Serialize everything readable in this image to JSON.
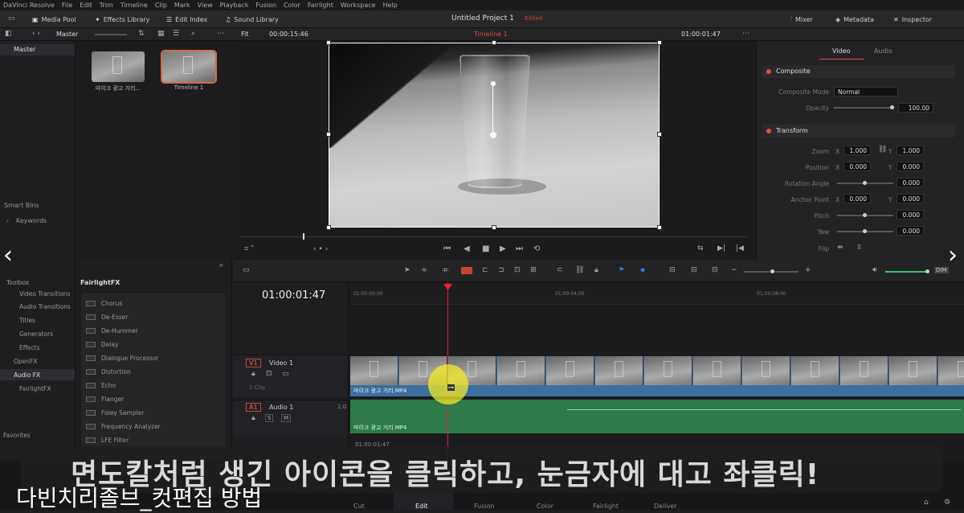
{
  "menu": [
    "DaVinci Resolve",
    "File",
    "Edit",
    "Trim",
    "Timeline",
    "Clip",
    "Mark",
    "View",
    "Playback",
    "Fusion",
    "Color",
    "Fairlight",
    "Workspace",
    "Help"
  ],
  "toolbar": {
    "media_pool": "Media Pool",
    "effects_library": "Effects Library",
    "edit_index": "Edit Index",
    "sound_library": "Sound Library",
    "project_title": "Untitled Project 1",
    "edited": "Edited",
    "mixer": "Mixer",
    "metadata": "Metadata",
    "inspector": "Inspector"
  },
  "subbar": {
    "master": "Master",
    "fit": "Fit",
    "timecode_left": "00:00:15:46",
    "timeline_name": "Timeline 1",
    "timecode_right": "01:00:01:47"
  },
  "bin": {
    "master": "Master",
    "smart_bins": "Smart Bins",
    "keywords": "Keywords"
  },
  "clips": [
    {
      "name": "마이크 광고 거리..."
    },
    {
      "name": "Timeline 1"
    }
  ],
  "inspector": {
    "tab_video": "Video",
    "tab_audio": "Audio",
    "composite": "Composite",
    "composite_mode_label": "Composite Mode",
    "composite_mode": "Normal",
    "opacity_label": "Opacity",
    "opacity": "100.00",
    "transform": "Transform",
    "zoom_label": "Zoom",
    "zoom_x": "1.000",
    "zoom_y": "1.000",
    "position_label": "Position",
    "position_x": "0.000",
    "position_y": "0.000",
    "rotation_label": "Rotation Angle",
    "rotation": "0.000",
    "anchor_label": "Anchor Point",
    "anchor_x": "0.000",
    "anchor_y": "0.000",
    "pitch_label": "Pitch",
    "pitch": "0.000",
    "yaw_label": "Yaw",
    "yaw": "0.000",
    "flip_label": "Flip",
    "x": "X",
    "y": "Y"
  },
  "tree": {
    "toolbox": "Toolbox",
    "video_transitions": "Video Transitions",
    "audio_transitions": "Audio Transitions",
    "titles": "Titles",
    "generators": "Generators",
    "effects": "Effects",
    "openfx": "OpenFX",
    "audio_fx": "Audio FX",
    "fairlightfx": "FairlightFX",
    "favorites": "Favorites"
  },
  "fx": {
    "header": "FairlightFX",
    "items": [
      "Chorus",
      "De-Esser",
      "De-Hummer",
      "Delay",
      "Dialogue Processor",
      "Distortion",
      "Echo",
      "Flanger",
      "Foley Sampler",
      "Frequency Analyzer",
      "LFE Filter"
    ]
  },
  "timeline": {
    "timecode": "01:00:01:47",
    "ruler": [
      "01:00:00:00",
      "01:00:04:00",
      "01:00:08:00"
    ],
    "v1": "V1",
    "video1": "Video 1",
    "clip_count": "1 Clip",
    "a1": "A1",
    "audio1": "Audio 1",
    "a1_level": "2.0",
    "clip_name": "마이크 광고 거리.MP4",
    "below_timecode": "01:00:01:47"
  },
  "pages": [
    "Cut",
    "Edit",
    "Fusion",
    "Color",
    "Fairlight",
    "Deliver"
  ],
  "caption": "면도칼처럼 생긴 아이콘을 클릭하고, 눈금자에 대고 좌클릭!",
  "footer": "다빈치리졸브_컷편집 방법",
  "colors": {
    "accent": "#d46a4a",
    "playhead": "#dd2233",
    "video_clip": "#3d6ea0",
    "audio_clip": "#2e7a4a"
  }
}
